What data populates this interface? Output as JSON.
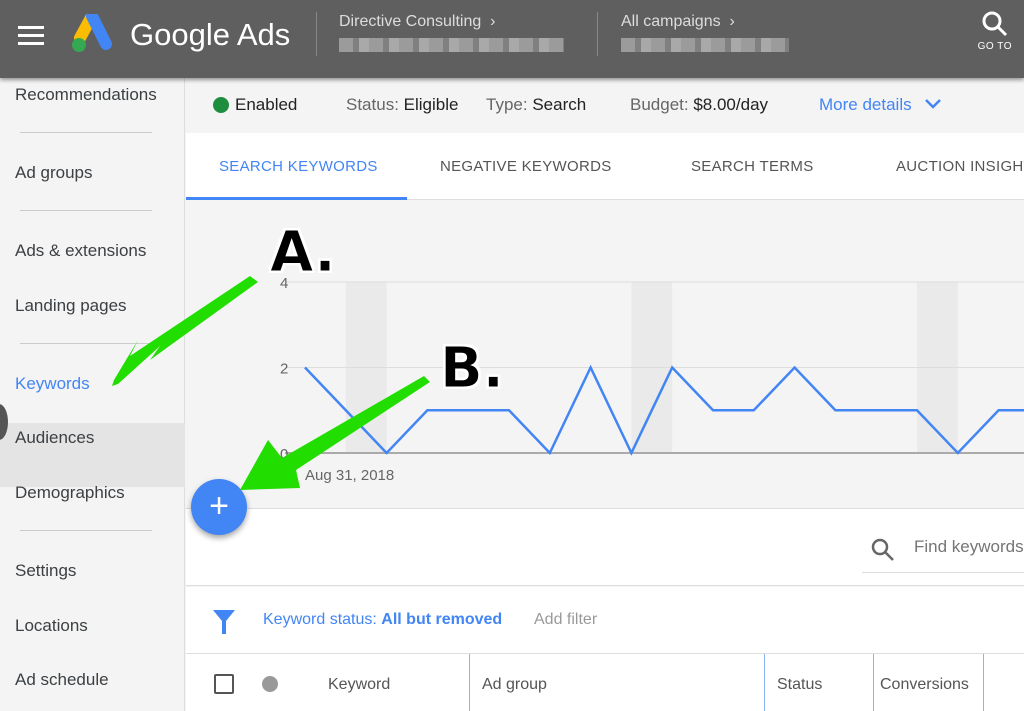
{
  "header": {
    "app_title": "Google Ads",
    "breadcrumb": [
      {
        "label": "Directive Consulting",
        "chevron": "›"
      },
      {
        "label": "All campaigns",
        "chevron": "›"
      }
    ],
    "goto_label": "GO TO"
  },
  "sidebar": {
    "items": [
      {
        "label": "Recommendations"
      },
      {
        "label": "Ad groups"
      },
      {
        "label": "Ads & extensions"
      },
      {
        "label": "Landing pages"
      },
      {
        "label": "Keywords",
        "selected": true
      },
      {
        "label": "Audiences"
      },
      {
        "label": "Demographics"
      },
      {
        "label": "Settings"
      },
      {
        "label": "Locations"
      },
      {
        "label": "Ad schedule"
      }
    ]
  },
  "status": {
    "enabled": "Enabled",
    "status_label": "Status:",
    "status_value": "Eligible",
    "type_label": "Type:",
    "type_value": "Search",
    "budget_label": "Budget:",
    "budget_value": "$8.00/day",
    "more_details": "More details",
    "enabled_color": "#1e8e3e"
  },
  "tabs": [
    {
      "label": "SEARCH KEYWORDS",
      "active": true
    },
    {
      "label": "NEGATIVE KEYWORDS"
    },
    {
      "label": "SEARCH TERMS"
    },
    {
      "label": "AUCTION INSIGHTS"
    }
  ],
  "chart_data": {
    "type": "line",
    "x_start_label": "Aug 31, 2018",
    "y_ticks": [
      "0",
      "2",
      "4"
    ],
    "ylim": [
      0,
      4
    ],
    "values": [
      2,
      1,
      0,
      1,
      1,
      1,
      0,
      2,
      0,
      2,
      1,
      1,
      2,
      1,
      1,
      1,
      0,
      1,
      1
    ],
    "weekend_bands": [
      [
        1,
        2
      ],
      [
        8,
        9
      ],
      [
        15,
        16
      ]
    ],
    "grid": true,
    "line_color": "#4285f4"
  },
  "toolbar": {
    "search_placeholder": "Find keywords"
  },
  "filter": {
    "label": "Keyword status:",
    "value": "All but removed",
    "add_filter": "Add filter"
  },
  "table": {
    "columns": [
      "Keyword",
      "Ad group",
      "Status",
      "Conversions"
    ]
  },
  "fab": {
    "label": "+"
  },
  "annotations": {
    "a": "A.",
    "b": "B.",
    "arrow_color": "#22dd00"
  },
  "accent": "#4285f4"
}
